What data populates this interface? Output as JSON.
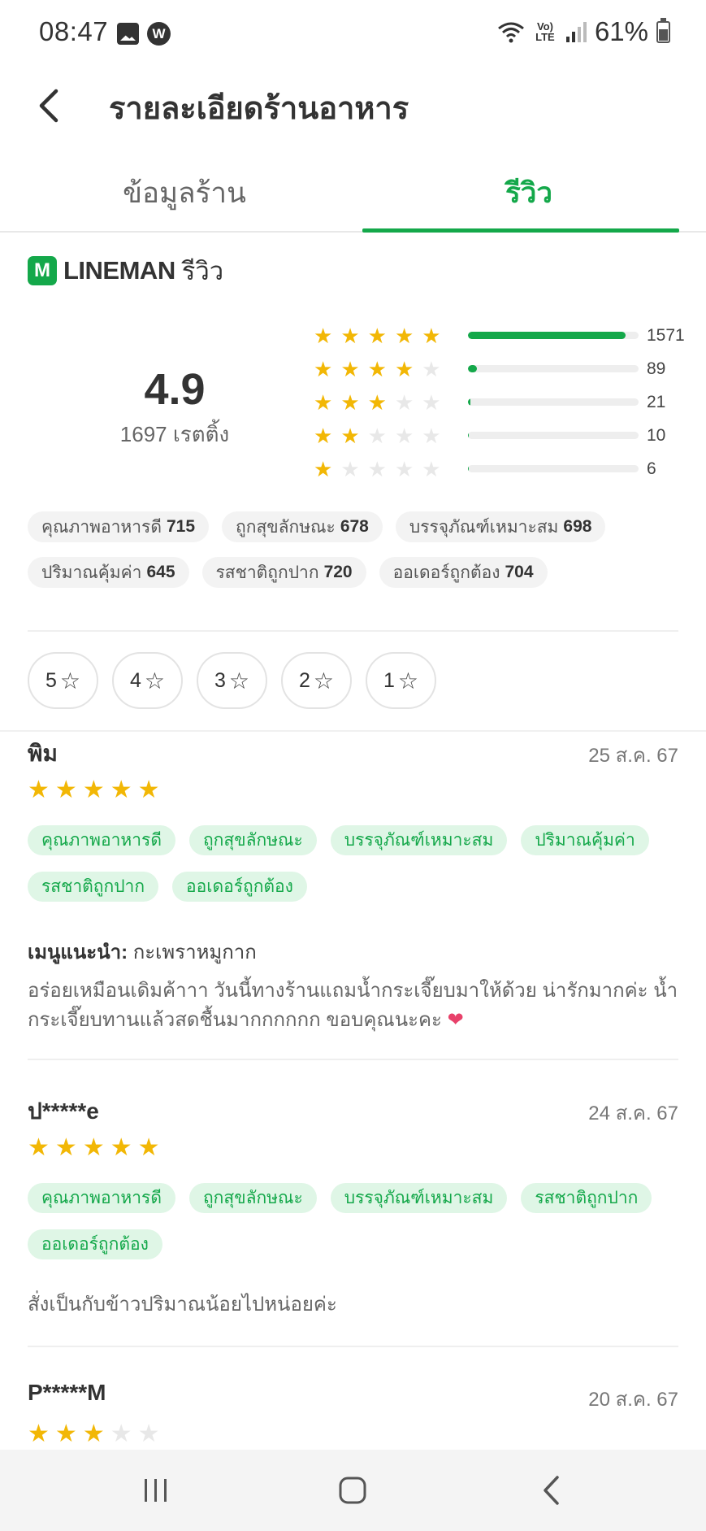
{
  "status": {
    "time": "08:47",
    "battery": "61%",
    "lte": "Vo) LTE",
    "w": "W",
    "icons": [
      "photo-icon",
      "w-app-icon",
      "wifi-icon",
      "volte-icon",
      "signal-icon",
      "battery-icon"
    ]
  },
  "header": {
    "title": "รายละเอียดร้านอาหาร"
  },
  "tabs": [
    {
      "label": "ข้อมูลร้าน",
      "active": false
    },
    {
      "label": "รีวิว",
      "active": true
    }
  ],
  "brand": {
    "logo_letter": "M",
    "name": "LINEMAN",
    "suffix": "รีวิว",
    "color": "#14a84a"
  },
  "summary": {
    "rating": "4.9",
    "count_label": "1697 เรตติ้ง",
    "distribution": [
      {
        "stars": 5,
        "count": "1571",
        "fraction": 0.926
      },
      {
        "stars": 4,
        "count": "89",
        "fraction": 0.052
      },
      {
        "stars": 3,
        "count": "21",
        "fraction": 0.012
      },
      {
        "stars": 2,
        "count": "10",
        "fraction": 0.006
      },
      {
        "stars": 1,
        "count": "6",
        "fraction": 0.004
      }
    ],
    "tags": [
      {
        "label": "คุณภาพอาหารดี",
        "count": "715"
      },
      {
        "label": "ถูกสุขลักษณะ",
        "count": "678"
      },
      {
        "label": "บรรจุภัณฑ์เหมาะสม",
        "count": "698"
      },
      {
        "label": "ปริมาณคุ้มค่า",
        "count": "645"
      },
      {
        "label": "รสชาติถูกปาก",
        "count": "720"
      },
      {
        "label": "ออเดอร์ถูกต้อง",
        "count": "704"
      }
    ]
  },
  "filters": [
    "5",
    "4",
    "3",
    "2",
    "1"
  ],
  "reviews": [
    {
      "name": "พิม",
      "date": "25 ส.ค. 67",
      "stars": 5,
      "tags": [
        "คุณภาพอาหารดี",
        "ถูกสุขลักษณะ",
        "บรรจุภัณฑ์เหมาะสม",
        "ปริมาณคุ้มค่า",
        "รสชาติถูกปาก",
        "ออเดอร์ถูกต้อง"
      ],
      "menu_label": "เมนูแนะนำ:",
      "menu": "กะเพราหมูกาก",
      "text_line1": "อร่อยเหมือนเดิมค้าาา วันนี้ทางร้านแถมน้ำกระเจี๊ยบมาให้ด้วย น่ารักมากค่ะ น้ำ",
      "text_line2": "กระเจี๊ยบทานแล้วสดชื้นมากกกกกก ขอบคุณนะคะ",
      "emoji": "❤"
    },
    {
      "name": "ป*****e",
      "date": "24 ส.ค. 67",
      "stars": 5,
      "tags": [
        "คุณภาพอาหารดี",
        "ถูกสุขลักษณะ",
        "บรรจุภัณฑ์เหมาะสม",
        "รสชาติถูกปาก",
        "ออเดอร์ถูกต้อง"
      ],
      "text": "สั่งเป็นกับข้าวปริมาณน้อยไปหน่อยค่ะ"
    },
    {
      "name": "P*****M",
      "date": "20 ส.ค. 67",
      "stars": 3
    }
  ],
  "star_glyph": "★",
  "star_outline_glyph": "☆"
}
